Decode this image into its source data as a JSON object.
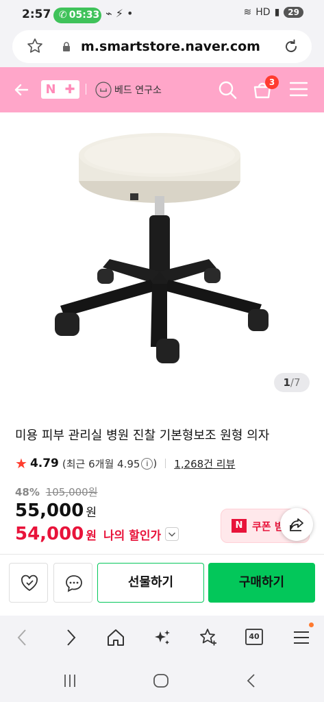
{
  "status": {
    "time": "2:57",
    "call_time": "05:33",
    "battery": "29"
  },
  "browser": {
    "url": "m.smartstore.naver.com"
  },
  "header": {
    "brand": "N+",
    "store_name": "베드 연구소",
    "cart_count": "3"
  },
  "gallery": {
    "current": "1",
    "total": "/7"
  },
  "product": {
    "title": "미용 피부 관리실 병원 진찰 기본형보조 원형 의자",
    "rating": "4.79",
    "recent_rating": "(최근 6개월 4.95",
    "reviews": "1,268건 리뷰",
    "discount_pct": "48%",
    "original_price": "105,000원",
    "price": "55,000",
    "price_unit": "원",
    "my_price": "54,000",
    "my_price_unit": "원",
    "my_price_label": "나의 할인가",
    "coupon_label": "쿠폰 받"
  },
  "actions": {
    "gift": "선물하기",
    "buy": "구매하기"
  },
  "colors": {
    "brand_pink": "#ffa6c9",
    "naver_green": "#03c75a",
    "sale_red": "#e8133a"
  }
}
